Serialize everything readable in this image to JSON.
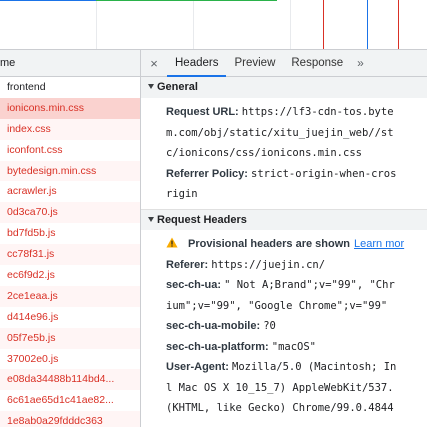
{
  "overview": {
    "markers": [
      {
        "color": "#d93025"
      },
      {
        "color": "#1a73e8"
      },
      {
        "color": "#d93025"
      }
    ]
  },
  "request_list": {
    "header": "me",
    "rows": [
      {
        "name": "frontend",
        "state": "plain"
      },
      {
        "name": "ionicons.min.css",
        "state": "selected"
      },
      {
        "name": "index.css",
        "state": "error"
      },
      {
        "name": "iconfont.css",
        "state": "error"
      },
      {
        "name": "bytedesign.min.css",
        "state": "error"
      },
      {
        "name": "acrawler.js",
        "state": "error"
      },
      {
        "name": "0d3ca70.js",
        "state": "error"
      },
      {
        "name": "bd7fd5b.js",
        "state": "error"
      },
      {
        "name": "cc78f31.js",
        "state": "error"
      },
      {
        "name": "ec6f9d2.js",
        "state": "error"
      },
      {
        "name": "2ce1eaa.js",
        "state": "error"
      },
      {
        "name": "d414e96.js",
        "state": "error"
      },
      {
        "name": "05f7e5b.js",
        "state": "error"
      },
      {
        "name": "37002e0.js",
        "state": "error"
      },
      {
        "name": "e08da34488b114bd4...",
        "state": "error"
      },
      {
        "name": "6c61ae65d1c41ae82...",
        "state": "error"
      },
      {
        "name": "1e8ab0a29fdddc363",
        "state": "error"
      }
    ]
  },
  "tabs": {
    "close": "×",
    "items": [
      "Headers",
      "Preview",
      "Response"
    ],
    "active": "Headers",
    "more": "»"
  },
  "general": {
    "title": "General",
    "request_url_key": "Request URL:",
    "request_url_line1": "https://lf3-cdn-tos.byte",
    "request_url_line2": "m.com/obj/static/xitu_juejin_web//st",
    "request_url_line3": "c/ionicons/css/ionicons.min.css",
    "referrer_policy_key": "Referrer Policy:",
    "referrer_policy_line1": "strict-origin-when-cros",
    "referrer_policy_line2": "rigin"
  },
  "request_headers": {
    "title": "Request Headers",
    "warning_text": "Provisional headers are shown",
    "learn_more": "Learn mor",
    "referer_key": "Referer:",
    "referer_value": "https://juejin.cn/",
    "sec_ch_ua_key": "sec-ch-ua:",
    "sec_ch_ua_line1": "\" Not A;Brand\";v=\"99\", \"Chr",
    "sec_ch_ua_line2": "ium\";v=\"99\", \"Google Chrome\";v=\"99\"",
    "mobile_key": "sec-ch-ua-mobile:",
    "mobile_value": "?0",
    "platform_key": "sec-ch-ua-platform:",
    "platform_value": "\"macOS\"",
    "ua_key": "User-Agent:",
    "ua_line1": "Mozilla/5.0 (Macintosh; In",
    "ua_line2": "l Mac OS X 10_15_7) AppleWebKit/537.",
    "ua_line3": "(KHTML, like Gecko) Chrome/99.0.4844"
  },
  "colors": {
    "error_text": "#d93025",
    "selected_bg": "#fad2cf",
    "accent": "#1a73e8",
    "warning": "#f9ab00"
  }
}
